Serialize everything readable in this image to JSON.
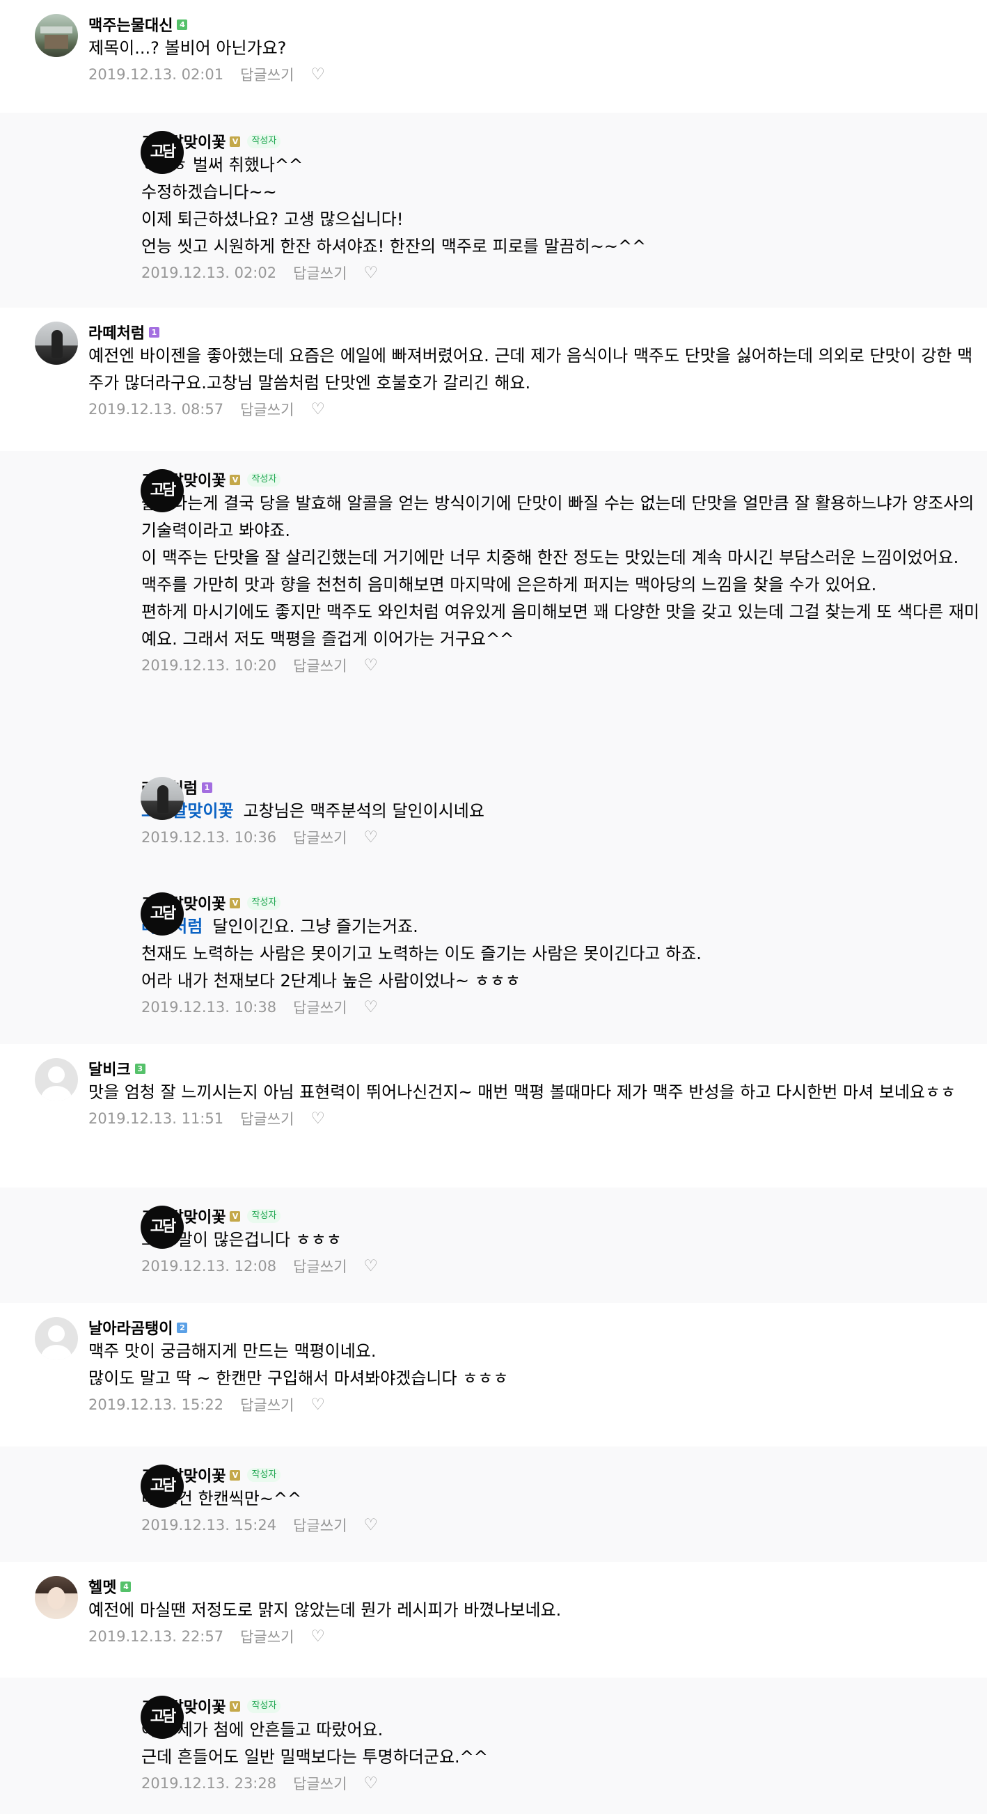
{
  "colors": {
    "page_bg": "#ffffff",
    "reply_bg": "#f9f9fa",
    "mention": "#0b63c4",
    "meta": "#979797",
    "writer_tag_bg": "#eafaef",
    "writer_tag_text": "#1ea650"
  },
  "comments": [
    {
      "nick": "맥주는물대신",
      "level": "4",
      "level_color": "#55c16a",
      "avatar": "photo-beer",
      "writer": false,
      "mention": "",
      "lines": [
        "제목이...? 볼비어 아닌가요?"
      ],
      "date": "2019.12.13. 02:01"
    },
    {
      "nick": "고창달맞이꽃",
      "level": "V",
      "level_color": "#c4a84a",
      "avatar": "logo",
      "writer": true,
      "mention": "",
      "lines": [
        "ㅎㅎㅎ 벌써 취했나^^",
        "수정하겠습니다~~",
        "이제 퇴근하셨나요? 고생 많으십니다!",
        "언능 씻고 시원하게 한잔 하셔야죠! 한잔의 맥주로 피로를 말끔히~~^^"
      ],
      "date": "2019.12.13. 02:02"
    },
    {
      "nick": "라떼처럼",
      "level": "1",
      "level_color": "#a36ee0",
      "avatar": "photo-silhouette",
      "writer": false,
      "mention": "",
      "lines": [
        "예전엔 바이젠을 좋아했는데 요즘은 에일에 빠져버렸어요. 근데 제가 음식이나 맥주도 단맛을 싫어하는데 의외로 단맛이 강한 맥주가 많더라구요.고창님 말씀처럼 단맛엔 호불호가 갈리긴 해요."
      ],
      "date": "2019.12.13. 08:57"
    },
    {
      "nick": "고창달맞이꽃",
      "level": "V",
      "level_color": "#c4a84a",
      "avatar": "logo",
      "writer": true,
      "mention": "",
      "lines": [
        "술이라는게 결국 당을 발효해 알콜을 얻는 방식이기에 단맛이 빠질 수는 없는데 단맛을 얼만큼 잘 활용하느냐가 양조사의 기술력이라고 봐야죠.",
        "이 맥주는 단맛을 잘 살리긴했는데 거기에만 너무 치중해 한잔 정도는 맛있는데 계속 마시긴 부담스러운 느낌이었어요.",
        "맥주를 가만히 맛과 향을 천천히 음미해보면 마지막에 은은하게 퍼지는 맥아당의 느낌을 찾을 수가 있어요.",
        "편하게 마시기에도 좋지만 맥주도 와인처럼 여유있게 음미해보면 꽤 다양한 맛을 갖고 있는데 그걸 찾는게 또 색다른 재미예요. 그래서 저도 맥평을 즐겁게 이어가는 거구요^^"
      ],
      "date": "2019.12.13. 10:20"
    },
    {
      "nick": "라떼처럼",
      "level": "1",
      "level_color": "#a36ee0",
      "avatar": "photo-silhouette",
      "writer": false,
      "mention": "고창달맞이꽃",
      "lines": [
        "고창님은 맥주분석의 달인이시네요"
      ],
      "date": "2019.12.13. 10:36"
    },
    {
      "nick": "고창달맞이꽃",
      "level": "V",
      "level_color": "#c4a84a",
      "avatar": "logo",
      "writer": true,
      "mention": "라떼처럼",
      "lines": [
        "달인이긴요. 그냥 즐기는거죠.",
        "천재도 노력하는 사람은 못이기고 노력하는 이도 즐기는 사람은 못이긴다고 하죠.",
        "어라 내가 천재보다 2단계나 높은 사람이었나~ ㅎㅎㅎ"
      ],
      "date": "2019.12.13. 10:38"
    },
    {
      "nick": "달비크",
      "level": "3",
      "level_color": "#55c16a",
      "avatar": "default",
      "writer": false,
      "mention": "",
      "lines": [
        "맛을 엄청 잘 느끼시는지 아님 표현력이 뛰어나신건지~ 매번 맥평 볼때마다 제가 맥주 반성을 하고 다시한번 마셔 보네요ㅎㅎ"
      ],
      "date": "2019.12.13. 11:51"
    },
    {
      "nick": "고창달맞이꽃",
      "level": "V",
      "level_color": "#c4a84a",
      "avatar": "logo",
      "writer": true,
      "mention": "",
      "lines": [
        "그냥 말이 많은겁니다 ㅎㅎㅎ"
      ],
      "date": "2019.12.13. 12:08"
    },
    {
      "nick": "날아라곰탱이",
      "level": "2",
      "level_color": "#5aa0e6",
      "avatar": "default",
      "writer": false,
      "mention": "",
      "lines": [
        "맥주 맛이 궁금해지게 만드는 맥평이네요.",
        "많이도 말고 딱 ~ 한캔만 구입해서 마셔봐야겠습니다 ㅎㅎㅎ"
      ],
      "date": "2019.12.13. 15:22"
    },
    {
      "nick": "고창달맞이꽃",
      "level": "V",
      "level_color": "#c4a84a",
      "avatar": "logo",
      "writer": true,
      "mention": "",
      "lines": [
        "네 요건 한캔씩만~^^"
      ],
      "date": "2019.12.13. 15:24"
    },
    {
      "nick": "헬멧",
      "level": "4",
      "level_color": "#55c16a",
      "avatar": "photo-face",
      "writer": false,
      "mention": "",
      "lines": [
        "예전에 마실땐 저정도로 맑지 않았는데 뭔가 레시피가 바꼈나보네요."
      ],
      "date": "2019.12.13. 22:57"
    },
    {
      "nick": "고창달맞이꽃",
      "level": "V",
      "level_color": "#c4a84a",
      "avatar": "logo",
      "writer": true,
      "mention": "",
      "lines": [
        "아녀 제가 첨에 안흔들고 따랐어요.",
        "근데 흔들어도 일반 밀맥보다는 투명하더군요.^^"
      ],
      "date": "2019.12.13. 23:28"
    }
  ],
  "labels": {
    "reply": "답글쓰기",
    "writer_tag": "작성자",
    "heart_icon": "heart-outline-icon",
    "logo_text": "고담"
  }
}
